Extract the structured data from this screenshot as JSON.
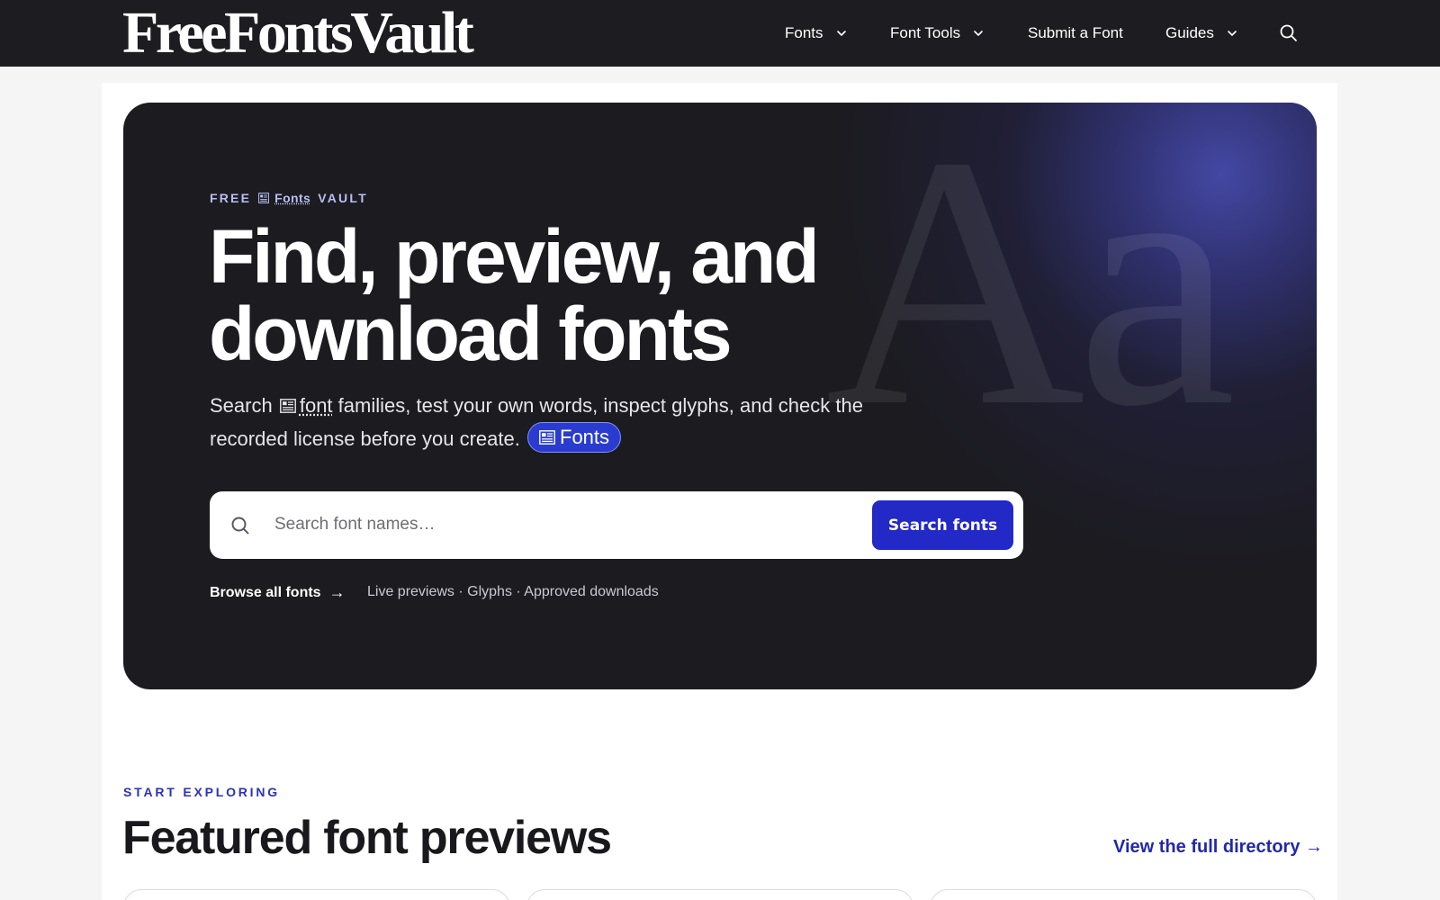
{
  "brand": {
    "logo_text": "FreeFontsVault"
  },
  "nav": {
    "items": [
      {
        "label": "Fonts",
        "has_dropdown": true
      },
      {
        "label": "Font Tools",
        "has_dropdown": true
      },
      {
        "label": "Submit a Font",
        "has_dropdown": false
      },
      {
        "label": "Guides",
        "has_dropdown": true
      }
    ],
    "search_icon": "search-icon"
  },
  "hero": {
    "eyebrow": {
      "part1": "FREE",
      "link": "Fonts",
      "part2": "VAULT"
    },
    "title": "Find, preview, and download fonts",
    "description": {
      "before": "Search",
      "link": "font",
      "after": "families, test your own words, inspect glyphs, and check the recorded license before you create."
    },
    "pill_label": "Fonts",
    "decor_glyphs": "Aa",
    "search": {
      "placeholder": "Search font names…",
      "value": "",
      "button_label": "Search fonts"
    },
    "browse_label": "Browse all fonts",
    "browse_arrow": "→",
    "features": "Live previews · Glyphs · Approved downloads"
  },
  "featured": {
    "kicker": "START EXPLORING",
    "title": "Featured font previews",
    "view_all": "View the full directory →"
  },
  "colors": {
    "topbar": "#1d1c21",
    "hero_bg": "#1c1b20",
    "accent": "#2229c6",
    "accent_text": "#2229a8",
    "eyebrow": "#b8bff2"
  }
}
